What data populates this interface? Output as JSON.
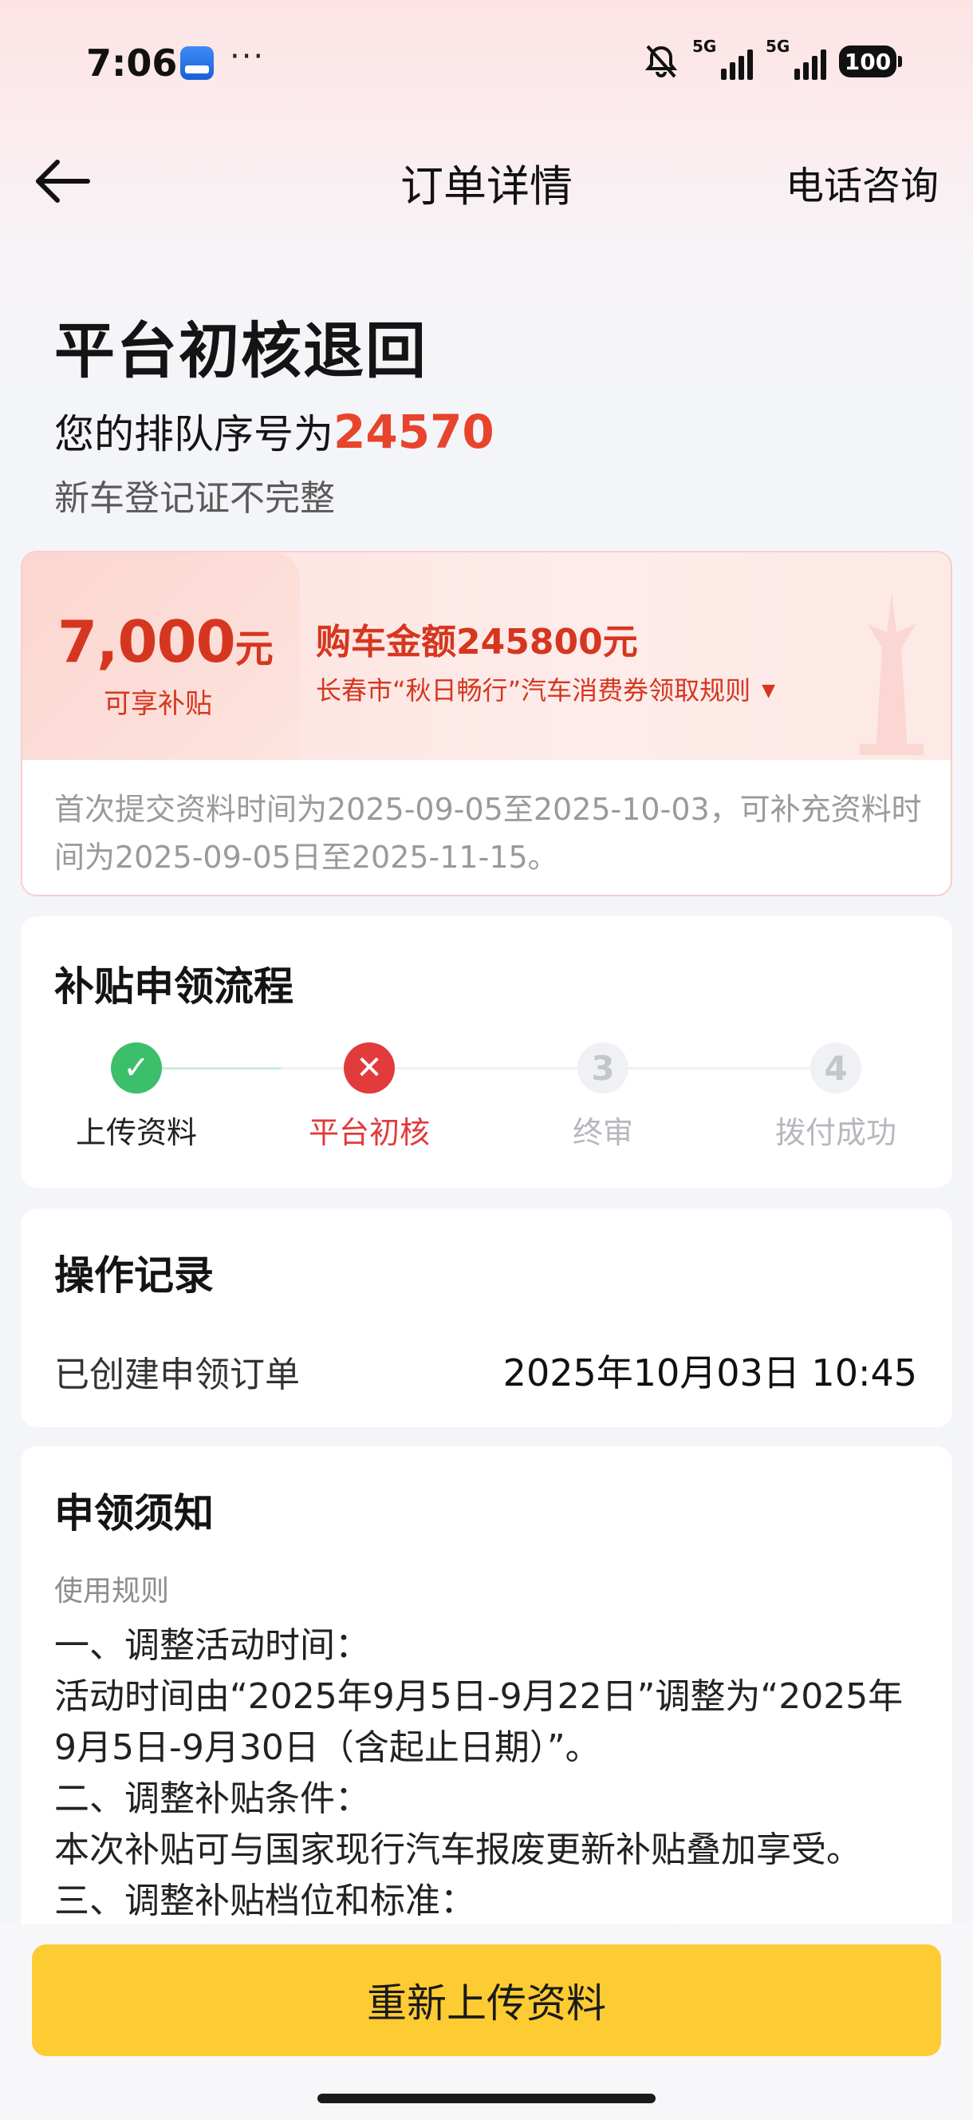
{
  "status_bar": {
    "time": "7:06",
    "app_icon": "autohome-app-icon",
    "more": "···",
    "network_1": "5G",
    "network_2": "5G",
    "battery": "100"
  },
  "nav": {
    "back_icon": "arrow-left-icon",
    "title": "订单详情",
    "action": "电话咨询"
  },
  "order": {
    "status_title": "平台初核退回",
    "queue_prefix": "您的排队序号为",
    "queue_number": "24570",
    "reason": "新车登记证不完整"
  },
  "subsidy": {
    "amount": "7,000",
    "amount_unit": "元",
    "amount_label": "可享补贴",
    "purchase_amount": "购车金额245800元",
    "rule_link": "长春市“秋日畅行”汽车消费券领取规则",
    "rule_link_icon": "triangle-down-icon",
    "note": "首次提交资料时间为2025-09-05至2025-10-03，可补充资料时间为2025-09-05日至2025-11-15。"
  },
  "process": {
    "title": "补贴申领流程",
    "steps": [
      {
        "label": "上传资料",
        "state": "done",
        "marker": "✓"
      },
      {
        "label": "平台初核",
        "state": "fail",
        "marker": "✕"
      },
      {
        "label": "终审",
        "state": "todo",
        "marker": "3"
      },
      {
        "label": "拨付成功",
        "state": "todo",
        "marker": "4"
      }
    ]
  },
  "log": {
    "title": "操作记录",
    "entries": [
      {
        "action": "已创建申领订单",
        "time": "2025年10月03日 10:45"
      }
    ]
  },
  "notice": {
    "title": "申领须知",
    "subtitle": "使用规则",
    "lines": [
      "一、调整活动时间：",
      "活动时间由“2025年9月5日-9月22日”调整为“2025年9月5日-9月30日（含起止日期）”。",
      "二、调整补贴条件：",
      "本次补贴可与国家现行汽车报废更新补贴叠加享受。",
      "三、调整补贴档位和标准："
    ]
  },
  "bottom": {
    "primary_button": "重新上传资料"
  },
  "colors": {
    "accent_red": "#d6361f",
    "success_green": "#3cbf6b",
    "error_red": "#e23b3b",
    "button_yellow": "#fdcb32"
  }
}
